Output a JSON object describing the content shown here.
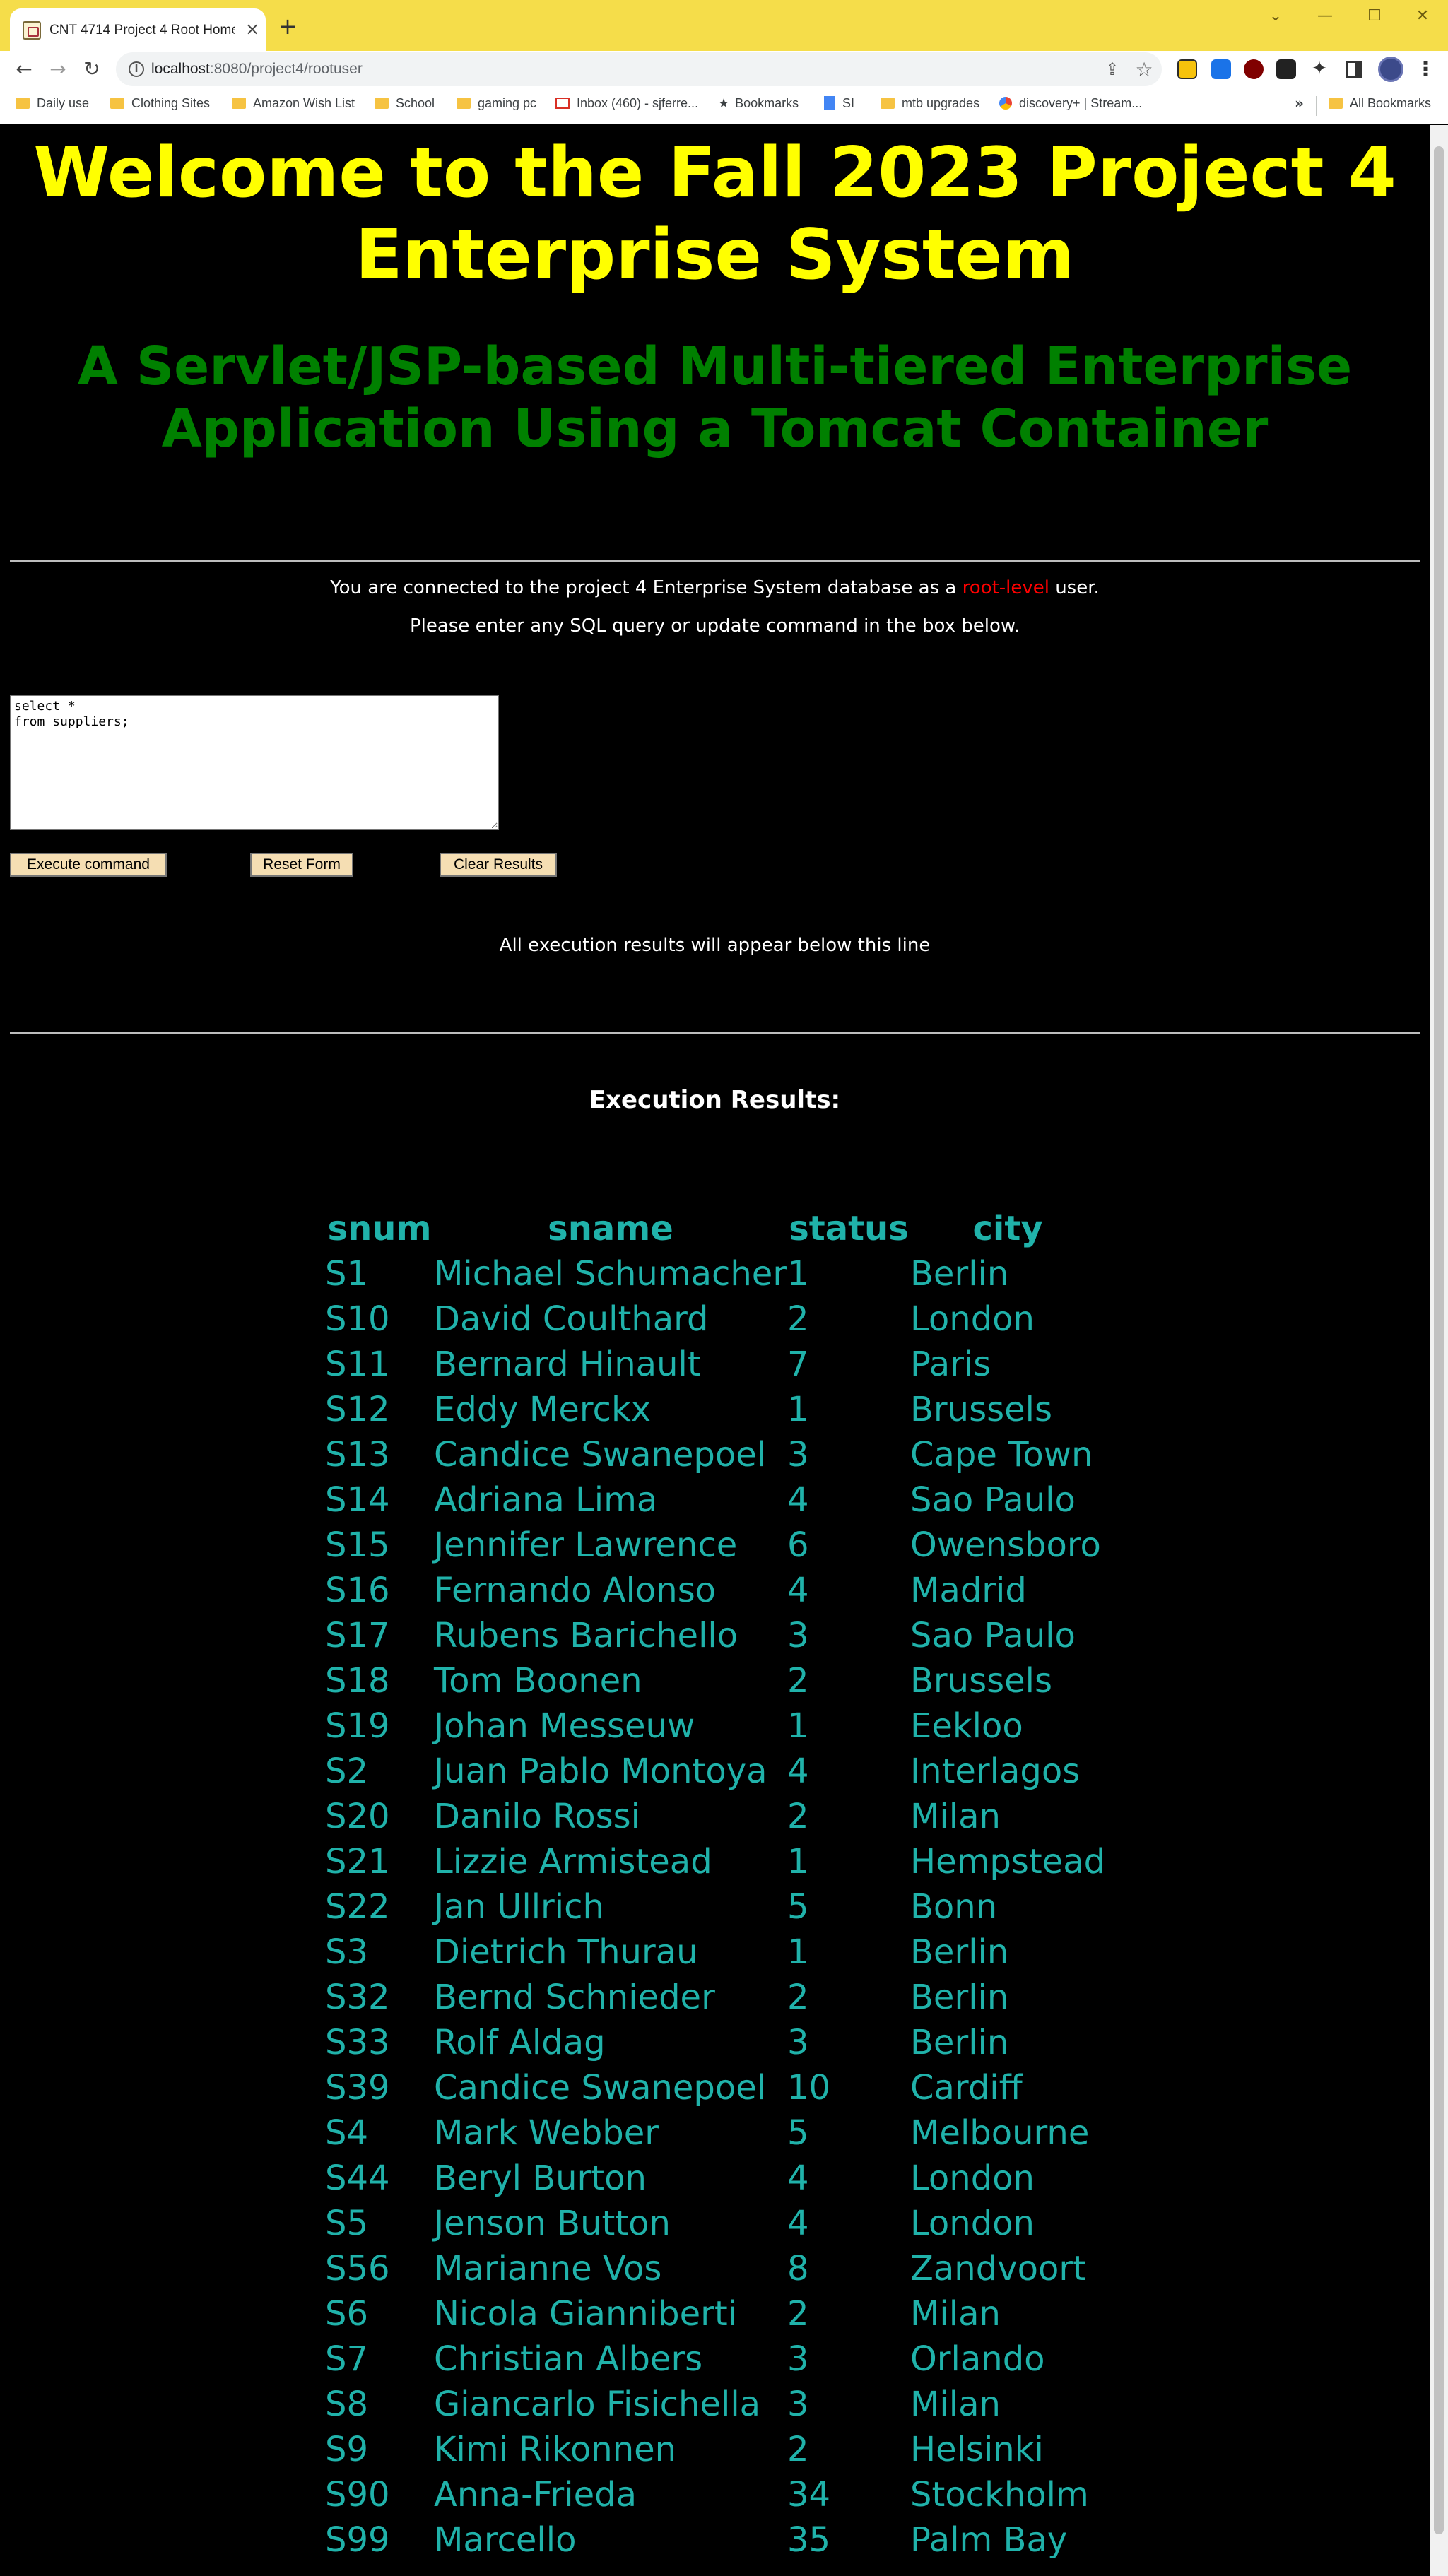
{
  "browser": {
    "tab_title": "CNT 4714 Project 4 Root Home",
    "url_host": "localhost",
    "url_path": ":8080/project4/rootuser",
    "bookmarks": [
      "Daily use",
      "Clothing Sites",
      "Amazon Wish List",
      "School",
      "gaming pc",
      "Inbox (460) - sjferre...",
      "Bookmarks",
      "SI",
      "mtb upgrades",
      "discovery+ | Stream..."
    ],
    "all_bookmarks": "All Bookmarks"
  },
  "page": {
    "title": "Welcome to the Fall 2023 Project 4 Enterprise System",
    "subtitle": "A Servlet/JSP-based Multi-tiered Enterprise Application Using a Tomcat Container",
    "connection_text_before": "You are connected to the project 4 Enterprise System database as a ",
    "connection_highlight": "root-level",
    "connection_text_after": " user.",
    "prompt": "Please enter any SQL query or update command in the box below.",
    "sql_query": "select *\nfrom suppliers;",
    "buttons": {
      "execute": "Execute command",
      "reset": "Reset Form",
      "clear": "Clear Results"
    },
    "results_note": "All execution results will appear below this line",
    "results_title": "Execution Results:"
  },
  "colors": {
    "title": "#ffff00",
    "subtitle": "#008000",
    "results_text": "#20b2aa",
    "highlight": "#ff0000",
    "tab_strip": "#f5dd4a"
  },
  "results": {
    "columns": [
      "snum",
      "sname",
      "status",
      "city"
    ],
    "rows": [
      [
        "S1",
        "Michael Schumacher",
        "1",
        "Berlin"
      ],
      [
        "S10",
        "David Coulthard",
        "2",
        "London"
      ],
      [
        "S11",
        "Bernard Hinault",
        "7",
        "Paris"
      ],
      [
        "S12",
        "Eddy Merckx",
        "1",
        "Brussels"
      ],
      [
        "S13",
        "Candice Swanepoel",
        "3",
        "Cape Town"
      ],
      [
        "S14",
        "Adriana Lima",
        "4",
        "Sao Paulo"
      ],
      [
        "S15",
        "Jennifer Lawrence",
        "6",
        "Owensboro"
      ],
      [
        "S16",
        "Fernando Alonso",
        "4",
        "Madrid"
      ],
      [
        "S17",
        "Rubens Barichello",
        "3",
        "Sao Paulo"
      ],
      [
        "S18",
        "Tom Boonen",
        "2",
        "Brussels"
      ],
      [
        "S19",
        "Johan Messeuw",
        "1",
        "Eekloo"
      ],
      [
        "S2",
        "Juan Pablo Montoya",
        "4",
        "Interlagos"
      ],
      [
        "S20",
        "Danilo Rossi",
        "2",
        "Milan"
      ],
      [
        "S21",
        "Lizzie Armistead",
        "1",
        "Hempstead"
      ],
      [
        "S22",
        "Jan Ullrich",
        "5",
        "Bonn"
      ],
      [
        "S3",
        "Dietrich Thurau",
        "1",
        "Berlin"
      ],
      [
        "S32",
        "Bernd Schnieder",
        "2",
        "Berlin"
      ],
      [
        "S33",
        "Rolf Aldag",
        "3",
        "Berlin"
      ],
      [
        "S39",
        "Candice Swanepoel",
        "10",
        "Cardiff"
      ],
      [
        "S4",
        "Mark Webber",
        "5",
        "Melbourne"
      ],
      [
        "S44",
        "Beryl Burton",
        "4",
        "London"
      ],
      [
        "S5",
        "Jenson Button",
        "4",
        "London"
      ],
      [
        "S56",
        "Marianne Vos",
        "8",
        "Zandvoort"
      ],
      [
        "S6",
        "Nicola Gianniberti",
        "2",
        "Milan"
      ],
      [
        "S7",
        "Christian Albers",
        "3",
        "Orlando"
      ],
      [
        "S8",
        "Giancarlo Fisichella",
        "3",
        "Milan"
      ],
      [
        "S9",
        "Kimi Rikonnen",
        "2",
        "Helsinki"
      ],
      [
        "S90",
        "Anna-Frieda",
        "34",
        "Stockholm"
      ],
      [
        "S99",
        "Marcello",
        "35",
        "Palm Bay"
      ]
    ]
  }
}
